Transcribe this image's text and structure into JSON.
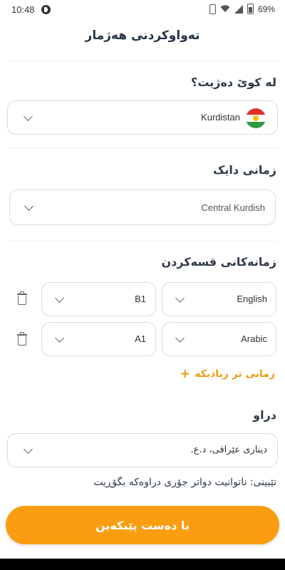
{
  "status_bar": {
    "time": "10:48",
    "battery": "69%"
  },
  "header": {
    "title": "تەواوکردنی هەژمار"
  },
  "location": {
    "label": "لە کوێ دەژیت؟",
    "value": "Kurdistan",
    "flag": "kurdistan-flag"
  },
  "native_language": {
    "label": "زمانی دایک",
    "value": "Central Kurdish"
  },
  "spoken_languages": {
    "label": "زمانەکانی قسەکردن",
    "rows": [
      {
        "language": "English",
        "level": "B1"
      },
      {
        "language": "Arabic",
        "level": "A1"
      }
    ],
    "add_label": "زمانی تر زیادبکە"
  },
  "currency": {
    "label": "دراو",
    "value": "دیناری عێراقی، د.ع.",
    "note": "تێبینی: ناتوانیت دواتر جۆری دراوەکە بگۆڕیت"
  },
  "submit": {
    "label": "با دەست پێبکەین"
  },
  "colors": {
    "accent": "#fb9d10",
    "text": "#2f3a48"
  }
}
